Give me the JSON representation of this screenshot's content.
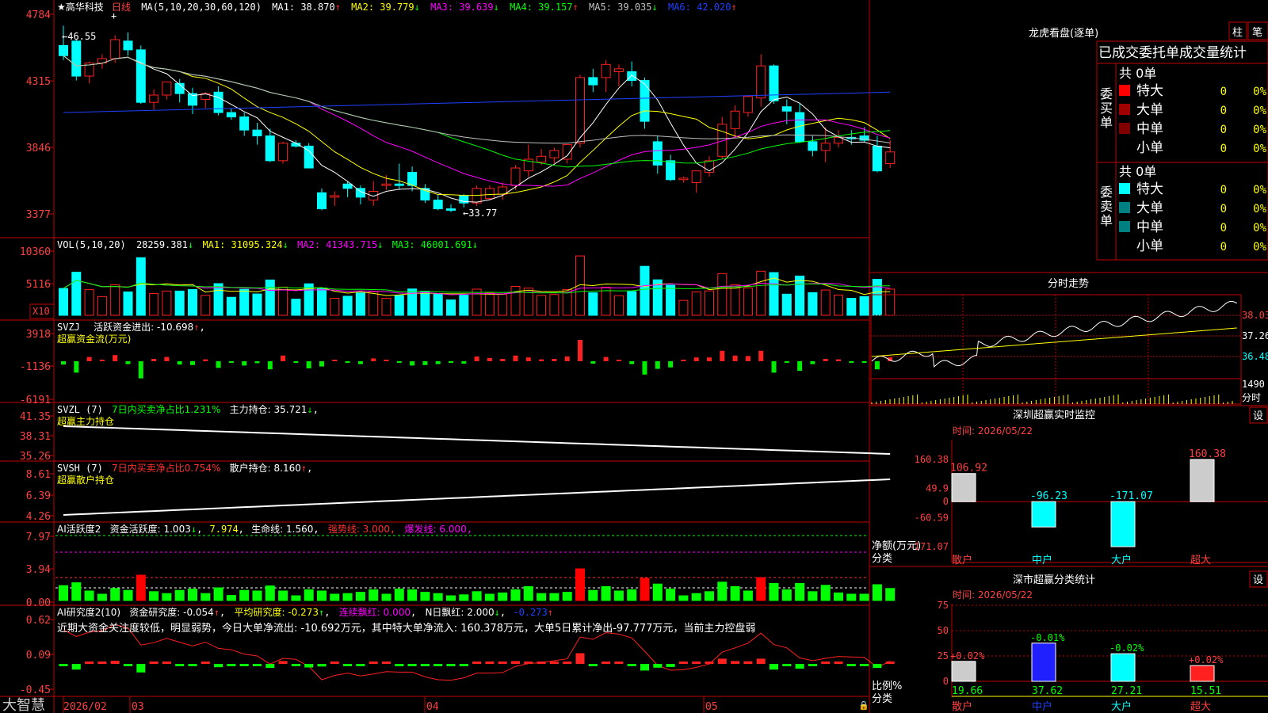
{
  "colors": {
    "up": "#ff2020",
    "down": "#00ffff",
    "ma1": "#ffffff",
    "ma2": "#ffff00",
    "ma3": "#ff00ff",
    "ma4": "#00ff00",
    "ma5": "#c0c0c0",
    "ma6": "#2040ff",
    "frame": "#c00000",
    "axis": "#ff4040"
  },
  "kline": {
    "title": "★高华科技",
    "period": "日线",
    "ma_params": "MA(5,10,20,30,60,120)",
    "ma1_label": "MA1: 38.870",
    "ma1_arrow": "↑",
    "ma2_label": "MA2: 39.779",
    "ma2_arrow": "↓",
    "ma3_label": "MA3: 39.639",
    "ma3_arrow": "↓",
    "ma4_label": "MA4: 39.157",
    "ma4_arrow": "↑",
    "ma5_label": "MA5: 39.035",
    "ma5_arrow": "↓",
    "ma6_label": "MA6: 42.020",
    "ma6_arrow": "↑",
    "y_ticks": [
      "4784",
      "4315",
      "3846",
      "3377"
    ],
    "high_label": "46.55",
    "low_label": "←33.77"
  },
  "vol": {
    "label": "VOL(5,10,20)",
    "value": "28259.381",
    "arrow": "↓",
    "ma1": "MA1: 31095.324",
    "ma2": "MA2: 41343.715",
    "ma3": "MA3: 46001.691",
    "y_ticks": [
      "10360",
      "5116"
    ],
    "unit": "X10"
  },
  "svzj": {
    "label": "SVZJ",
    "text": "活跃资金进出: -10.698",
    "arrow": "↑",
    "sub": "超赢资金流(万元)",
    "y_ticks": [
      "3918",
      "-1136",
      "-6191"
    ]
  },
  "svzl": {
    "label": "SVZL (7)",
    "text1": "7日内买卖净占比1.231%",
    "text2": "主力持仓: 35.721",
    "arrow": "↓",
    "sub": "超赢主力持仓",
    "y_ticks": [
      "41.35",
      "38.31",
      "35.26"
    ]
  },
  "svsh": {
    "label": "SVSH (7)",
    "text1": "7日内买卖净占比0.754%",
    "text2": "散户持仓: 8.160",
    "arrow": "↑",
    "sub": "超赢散户持仓",
    "y_ticks": [
      "8.61",
      "6.39",
      "4.26"
    ]
  },
  "ai_active": {
    "label": "AI活跃度2",
    "text1": "资金活跃度: 1.003",
    "arrow1": "↓",
    "text2": "7.974",
    "text3": "生命线: 1.560",
    "text4": "强势线: 3.000",
    "text5": "爆发线: 6.000",
    "y_ticks": [
      "7.97",
      "3.94",
      "0.00"
    ]
  },
  "ai_research": {
    "label": "AI研究度2(10)",
    "text1": "资金研究度: -0.054",
    "text2": "平均研究度: -0.273",
    "text3": "连续飘红: 0.000",
    "text4": "N日飘红: 2.000",
    "text5": "-0.273",
    "comment": "近期大资金关注度较低，明显弱势，今日大单净流出: -10.692万元，其中特大单净流入: 160.378万元，大单5日累计净出-97.777万元，当前主力控盘弱",
    "y_ticks": [
      "0.62",
      "0.09",
      "-0.45"
    ]
  },
  "x_axis": {
    "labels": [
      "2026/02",
      "03",
      "04",
      "05"
    ]
  },
  "logo": "大智慧",
  "dragon": {
    "title": "龙虎看盘(逐单)",
    "btn1": "柱",
    "btn2": "笔",
    "header": "已成交委托单成交量统计",
    "buy_label": "委买单",
    "sell_label": "委卖单",
    "buy_total": "共 0单",
    "sell_total": "共 0单",
    "rows": [
      {
        "name": "特大",
        "vol": "0",
        "pct": "0%"
      },
      {
        "name": "大单",
        "vol": "0",
        "pct": "0%"
      },
      {
        "name": "中单",
        "vol": "0",
        "pct": "0%"
      },
      {
        "name": "小单",
        "vol": "0",
        "pct": "0%"
      }
    ]
  },
  "intraday": {
    "title": "分时走势",
    "y_ticks": [
      "38.03",
      "37.26",
      "36.48"
    ],
    "vol_tick": "1490",
    "vol_unit": "分时"
  },
  "monitor": {
    "title": "深圳超赢实时监控",
    "btn": "设",
    "time": "时间: 2026/05/22",
    "y_ticks": [
      "160.38",
      "49.9",
      "0",
      "-60.59",
      "-171.07"
    ],
    "y_title": "净额(万元)",
    "x_title": "分类",
    "categories": [
      "散户",
      "中户",
      "大户",
      "超大"
    ],
    "values": [
      106.92,
      -96.23,
      -171.07,
      160.38
    ],
    "value_labels": [
      "106.92",
      "-96.23",
      "-171.07",
      "160.38"
    ]
  },
  "classify": {
    "title": "深市超赢分类统计",
    "btn": "设",
    "time": "时间: 2026/05/22",
    "y_ticks": [
      "75",
      "50",
      "25",
      "0"
    ],
    "y_title": "比例%",
    "x_title": "分类",
    "categories": [
      "散户",
      "中户",
      "大户",
      "超大"
    ],
    "values": [
      19.66,
      37.62,
      27.21,
      15.51
    ],
    "value_labels": [
      "19.66",
      "37.62",
      "27.21",
      "15.51"
    ],
    "change_labels": [
      "+0.02%",
      "-0.01%",
      "-0.02%",
      "+0.02%"
    ]
  },
  "chart_data": {
    "type": "candlestick",
    "series": [
      {
        "name": "K",
        "ohlc": [
          [
            45.2,
            46.55,
            44.2,
            44.5
          ],
          [
            45.5,
            45.6,
            42.8,
            43.1
          ],
          [
            43.1,
            44.1,
            42.6,
            44.0
          ],
          [
            44.0,
            44.6,
            43.6,
            44.3
          ],
          [
            44.3,
            45.9,
            44.0,
            45.6
          ],
          [
            45.5,
            46.1,
            44.5,
            44.9
          ],
          [
            44.9,
            45.2,
            41.2,
            41.3
          ],
          [
            41.3,
            42.2,
            40.8,
            41.8
          ],
          [
            41.8,
            42.6,
            41.5,
            42.7
          ],
          [
            42.6,
            42.9,
            41.3,
            41.9
          ],
          [
            41.9,
            42.3,
            40.5,
            41.1
          ],
          [
            41.5,
            42.0,
            40.9,
            41.9
          ],
          [
            42.0,
            42.4,
            40.4,
            40.6
          ],
          [
            40.6,
            40.9,
            40.1,
            40.3
          ],
          [
            40.3,
            40.6,
            39.0,
            39.4
          ],
          [
            39.4,
            39.9,
            38.4,
            39.0
          ],
          [
            39.0,
            39.5,
            37.2,
            37.3
          ],
          [
            37.3,
            38.6,
            37.1,
            38.5
          ],
          [
            38.5,
            38.7,
            38.2,
            38.3
          ],
          [
            38.3,
            38.5,
            36.8,
            36.8
          ],
          [
            35.1,
            35.4,
            33.9,
            34.0
          ],
          [
            34.8,
            35.2,
            34.2,
            34.9
          ],
          [
            35.7,
            35.9,
            34.8,
            35.4
          ],
          [
            35.4,
            35.6,
            34.3,
            34.8
          ],
          [
            34.6,
            35.9,
            34.2,
            35.2
          ],
          [
            35.6,
            36.3,
            35.3,
            35.7
          ],
          [
            35.7,
            37.1,
            35.3,
            35.6
          ],
          [
            36.5,
            36.9,
            35.2,
            35.6
          ],
          [
            35.4,
            35.7,
            34.4,
            34.6
          ],
          [
            34.6,
            35.0,
            33.9,
            34.0
          ],
          [
            34.0,
            34.3,
            33.77,
            33.9
          ],
          [
            34.9,
            35.0,
            34.1,
            34.4
          ],
          [
            34.4,
            35.6,
            34.2,
            35.4
          ],
          [
            34.7,
            35.6,
            34.6,
            35.4
          ],
          [
            35.0,
            35.8,
            34.6,
            35.5
          ],
          [
            35.6,
            37.0,
            35.3,
            36.8
          ],
          [
            36.6,
            38.4,
            36.2,
            37.4
          ],
          [
            37.2,
            38.1,
            37.0,
            37.6
          ],
          [
            37.5,
            38.2,
            37.1,
            38.0
          ],
          [
            37.4,
            38.4,
            37.1,
            38.4
          ],
          [
            38.5,
            43.2,
            38.2,
            43.0
          ],
          [
            43.0,
            43.6,
            42.0,
            42.5
          ],
          [
            43.0,
            44.2,
            42.0,
            43.9
          ],
          [
            43.4,
            43.9,
            42.4,
            43.6
          ],
          [
            43.4,
            44.1,
            42.4,
            42.8
          ],
          [
            42.8,
            43.0,
            39.5,
            40.0
          ],
          [
            38.6,
            39.0,
            36.4,
            37.0
          ],
          [
            37.3,
            37.7,
            35.9,
            36.0
          ],
          [
            36.0,
            36.2,
            35.8,
            36.1
          ],
          [
            35.8,
            36.2,
            35.1,
            36.6
          ],
          [
            36.5,
            37.6,
            36.2,
            37.3
          ],
          [
            37.6,
            40.3,
            37.4,
            39.8
          ],
          [
            39.5,
            41.1,
            38.9,
            40.7
          ],
          [
            40.6,
            41.8,
            40.3,
            41.7
          ],
          [
            41.6,
            44.6,
            41.0,
            43.8
          ],
          [
            43.8,
            43.9,
            41.2,
            41.4
          ],
          [
            41.0,
            41.5,
            39.8,
            40.7
          ],
          [
            40.6,
            41.2,
            38.5,
            38.6
          ],
          [
            38.6,
            39.0,
            37.6,
            38.0
          ],
          [
            38.0,
            39.6,
            37.2,
            38.5
          ],
          [
            38.5,
            39.4,
            38.2,
            38.9
          ],
          [
            38.9,
            39.4,
            38.4,
            38.8
          ],
          [
            39.0,
            39.6,
            38.6,
            38.7
          ],
          [
            38.3,
            39.0,
            36.5,
            36.6
          ],
          [
            37.1,
            38.7,
            36.8,
            37.9
          ]
        ]
      }
    ]
  }
}
